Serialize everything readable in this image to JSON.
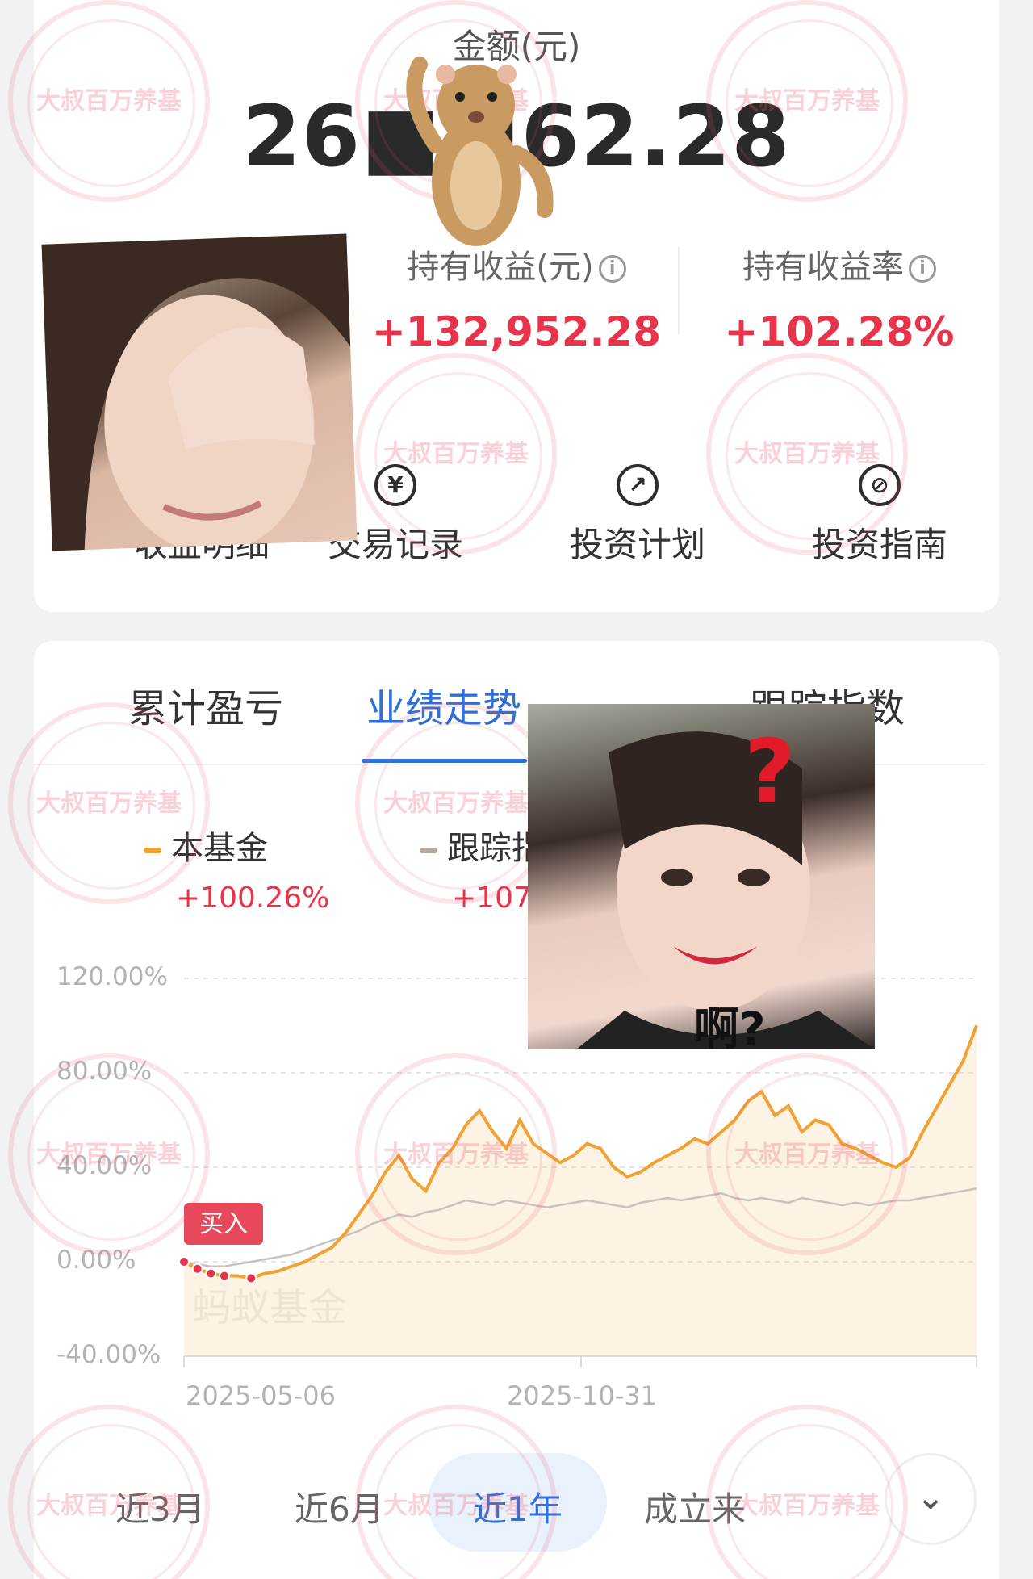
{
  "header": {
    "amount_label": "金额(元)",
    "amount_value": "26■■62.28"
  },
  "stats": [
    {
      "label": "持有收益(元)",
      "value": "+132,952.28"
    },
    {
      "label": "持有收益率",
      "value": "+102.28%"
    }
  ],
  "shortcuts": [
    {
      "label": "收益明细",
      "icon": "list-icon"
    },
    {
      "label": "交易记录",
      "icon": "yen-icon"
    },
    {
      "label": "投资计划",
      "icon": "trend-icon"
    },
    {
      "label": "投资指南",
      "icon": "compass-icon"
    }
  ],
  "tabs": [
    {
      "label": "累计盈亏",
      "active": false
    },
    {
      "label": "业绩走势",
      "active": true
    },
    {
      "label": "跟踪指数",
      "active": false
    }
  ],
  "legend": [
    {
      "name": "本基金",
      "value": "+100.26%",
      "color": "#f0a233"
    },
    {
      "name": "跟踪指数",
      "value": "+107.",
      "color": "#b9a99c"
    }
  ],
  "chart_data": {
    "type": "line",
    "y_ticks": [
      "120.00%",
      "80.00%",
      "40.00%",
      "0.00%",
      "-40.00%"
    ],
    "ylim": [
      -40,
      120
    ],
    "x_ticks": [
      "2025-05-06",
      "2025-10-31"
    ],
    "watermark": "蚂蚁基金",
    "annotation": "买入",
    "series": [
      {
        "color": "#f0a233",
        "values": [
          0,
          -3,
          -5,
          -6,
          -6,
          -7,
          -5,
          -4,
          -2,
          0,
          3,
          6,
          12,
          20,
          28,
          38,
          45,
          35,
          30,
          42,
          48,
          58,
          64,
          55,
          48,
          60,
          50,
          46,
          42,
          45,
          50,
          48,
          40,
          36,
          38,
          42,
          45,
          48,
          52,
          50,
          55,
          60,
          68,
          72,
          62,
          66,
          55,
          60,
          58,
          50,
          48,
          45,
          42,
          40,
          44,
          55,
          65,
          75,
          85,
          100
        ]
      },
      {
        "color": "#c8c2bc",
        "values": [
          0,
          -1,
          -2,
          -2,
          -1,
          0,
          1,
          2,
          3,
          5,
          7,
          9,
          11,
          13,
          16,
          18,
          20,
          19,
          21,
          22,
          24,
          26,
          25,
          24,
          26,
          25,
          24,
          23,
          24,
          25,
          26,
          25,
          24,
          23,
          25,
          26,
          27,
          26,
          27,
          28,
          29,
          27,
          26,
          27,
          26,
          25,
          27,
          26,
          25,
          24,
          25,
          24,
          25,
          26,
          26,
          27,
          28,
          29,
          30,
          31
        ]
      }
    ]
  },
  "ranges": [
    {
      "label": "近3月",
      "active": false
    },
    {
      "label": "近6月",
      "active": false
    },
    {
      "label": "近1年",
      "active": true
    },
    {
      "label": "成立来",
      "active": false
    }
  ],
  "stamp_text": "大叔百万养基",
  "sticker": {
    "caption": "啊?",
    "question_mark": "?"
  }
}
